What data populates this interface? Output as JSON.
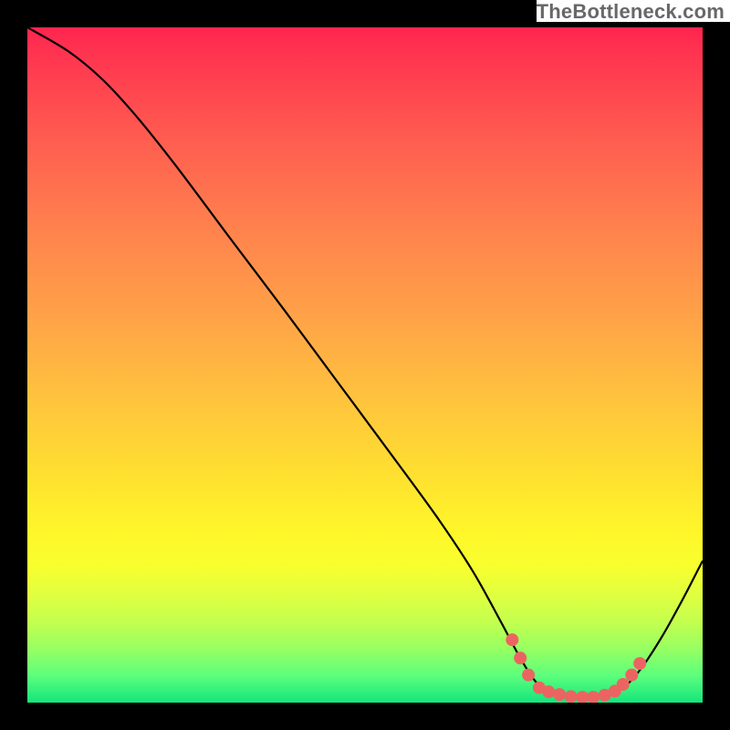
{
  "watermark": "TheBottleneck.com",
  "chart_data": {
    "type": "line",
    "title": "",
    "xlabel": "",
    "ylabel": "",
    "xlim": [
      0,
      1
    ],
    "ylim": [
      0,
      1
    ],
    "series": [
      {
        "name": "curve",
        "points": [
          [
            0.0,
            1.0
          ],
          [
            0.06,
            0.965
          ],
          [
            0.11,
            0.924
          ],
          [
            0.16,
            0.87
          ],
          [
            0.22,
            0.795
          ],
          [
            0.3,
            0.688
          ],
          [
            0.38,
            0.582
          ],
          [
            0.46,
            0.474
          ],
          [
            0.54,
            0.366
          ],
          [
            0.61,
            0.27
          ],
          [
            0.66,
            0.194
          ],
          [
            0.7,
            0.122
          ],
          [
            0.73,
            0.066
          ],
          [
            0.752,
            0.032
          ],
          [
            0.772,
            0.016
          ],
          [
            0.8,
            0.008
          ],
          [
            0.83,
            0.006
          ],
          [
            0.86,
            0.01
          ],
          [
            0.885,
            0.024
          ],
          [
            0.91,
            0.052
          ],
          [
            0.94,
            0.098
          ],
          [
            0.97,
            0.152
          ],
          [
            1.0,
            0.21
          ]
        ]
      }
    ],
    "highlight_dots": [
      [
        0.718,
        0.093
      ],
      [
        0.73,
        0.066
      ],
      [
        0.742,
        0.041
      ],
      [
        0.758,
        0.022
      ],
      [
        0.772,
        0.016
      ],
      [
        0.788,
        0.012
      ],
      [
        0.805,
        0.009
      ],
      [
        0.822,
        0.008
      ],
      [
        0.838,
        0.008
      ],
      [
        0.855,
        0.011
      ],
      [
        0.87,
        0.017
      ],
      [
        0.882,
        0.027
      ],
      [
        0.895,
        0.041
      ],
      [
        0.907,
        0.058
      ]
    ],
    "dot_color": "#ec6461",
    "gradient_stops": [
      [
        "0%",
        "#ff244e"
      ],
      [
        "15%",
        "#ff5850"
      ],
      [
        "42%",
        "#ffa048"
      ],
      [
        "67%",
        "#ffe22f"
      ],
      [
        "80%",
        "#f7ff2e"
      ],
      [
        "92%",
        "#97ff62"
      ],
      [
        "100%",
        "#14e57c"
      ]
    ]
  }
}
